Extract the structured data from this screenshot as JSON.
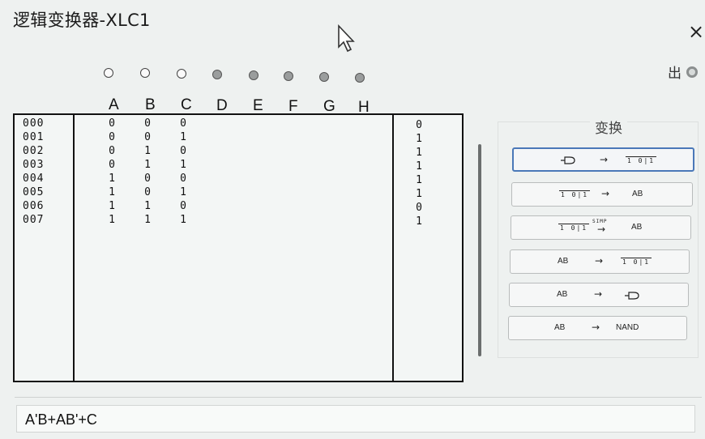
{
  "window": {
    "title": "逻辑变换器-XLC1",
    "close_label": "×"
  },
  "output": {
    "label": "出"
  },
  "inputs": {
    "variables": [
      {
        "name": "A",
        "active": true
      },
      {
        "name": "B",
        "active": true
      },
      {
        "name": "C",
        "active": true
      },
      {
        "name": "D",
        "active": false
      },
      {
        "name": "E",
        "active": false
      },
      {
        "name": "F",
        "active": false
      },
      {
        "name": "G",
        "active": false
      },
      {
        "name": "H",
        "active": false
      }
    ]
  },
  "truth_table": {
    "rows": [
      {
        "index": "000",
        "A": "0",
        "B": "0",
        "C": "0",
        "out": "0"
      },
      {
        "index": "001",
        "A": "0",
        "B": "0",
        "C": "1",
        "out": "1"
      },
      {
        "index": "002",
        "A": "0",
        "B": "1",
        "C": "0",
        "out": "1"
      },
      {
        "index": "003",
        "A": "0",
        "B": "1",
        "C": "1",
        "out": "1"
      },
      {
        "index": "004",
        "A": "1",
        "B": "0",
        "C": "0",
        "out": "1"
      },
      {
        "index": "005",
        "A": "1",
        "B": "0",
        "C": "1",
        "out": "1"
      },
      {
        "index": "006",
        "A": "1",
        "B": "1",
        "C": "0",
        "out": "0"
      },
      {
        "index": "007",
        "A": "1",
        "B": "1",
        "C": "1",
        "out": "1"
      }
    ]
  },
  "conversions": {
    "title": "变换",
    "truth_icon_text": "1 0|1",
    "expr_text": "AB",
    "arrow": "→",
    "simp_label": "SIMP",
    "nand_label": "NAND",
    "gate_icon": "logic-gate-icon"
  },
  "expression": {
    "value": "A'B+AB'+C"
  }
}
